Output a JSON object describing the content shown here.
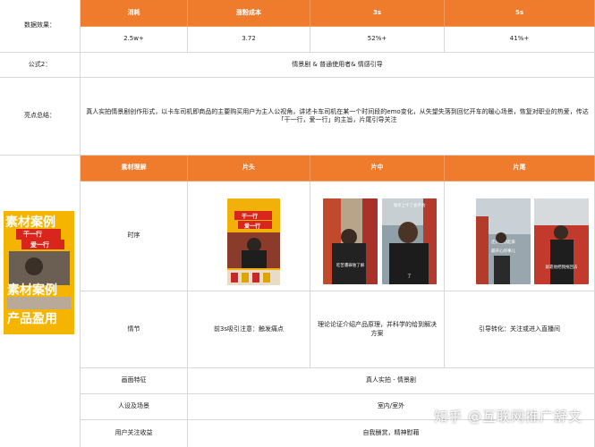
{
  "section1": {
    "label": "数据效果：",
    "headers": [
      "消耗",
      "涨粉成本",
      "3s",
      "5s"
    ],
    "values": [
      "2.5w+",
      "3.72",
      "52%+",
      "41%+"
    ]
  },
  "section2": {
    "label": "公式2：",
    "text": "情景剧 & 普通使用者& 情感引导"
  },
  "section3": {
    "label": "亮点总结：",
    "text": "真人实拍情景剧创作形式，以卡车司机即商品的主要购买用户为主人公视角，讲述卡车司机在某一个时间段的emo变化，从失望失落到回忆开车的暖心场景，恢复对职业的热爱，传达「干一行，爱一行」的主旨，片尾引导关注"
  },
  "left_image": {
    "lines": [
      "素材案例",
      "干一行",
      "爱一行",
      "素材案例",
      "产品盈用"
    ]
  },
  "section4": {
    "headers": [
      "素材理解",
      "片头",
      "片中",
      "片尾"
    ],
    "row_sequence_label": "时序",
    "thumb_captions": {
      "head_title_1": "干一行",
      "head_title_2": "爱一行",
      "mid1": "吃苦遭罪谁了解",
      "mid2_top": "瑞幸上午了会不会",
      "mid2_bottom": "了",
      "end1_top": "还有回想起来",
      "end1_bottom": "最开心的事儿",
      "end2": "就靠他把我拖回去"
    },
    "row_plot_label": "情节",
    "plot": [
      "前3s吸引注意：触发痛点",
      "理论论证介绍产品原理，并科学的给到解决方案",
      "引导转化：关注或进入直播间"
    ],
    "rows": [
      {
        "label": "画面特征",
        "value": "真人实拍 - 情景剧"
      },
      {
        "label": "人设及场景",
        "value": "室内/室外"
      },
      {
        "label": "用户关注收益",
        "value": "自我酬赏，精神慰藉"
      }
    ]
  },
  "watermark": "知乎 @互联网推广舒文",
  "colors": {
    "accent": "#ef7b2d",
    "accent_yellow": "#f4b400"
  }
}
